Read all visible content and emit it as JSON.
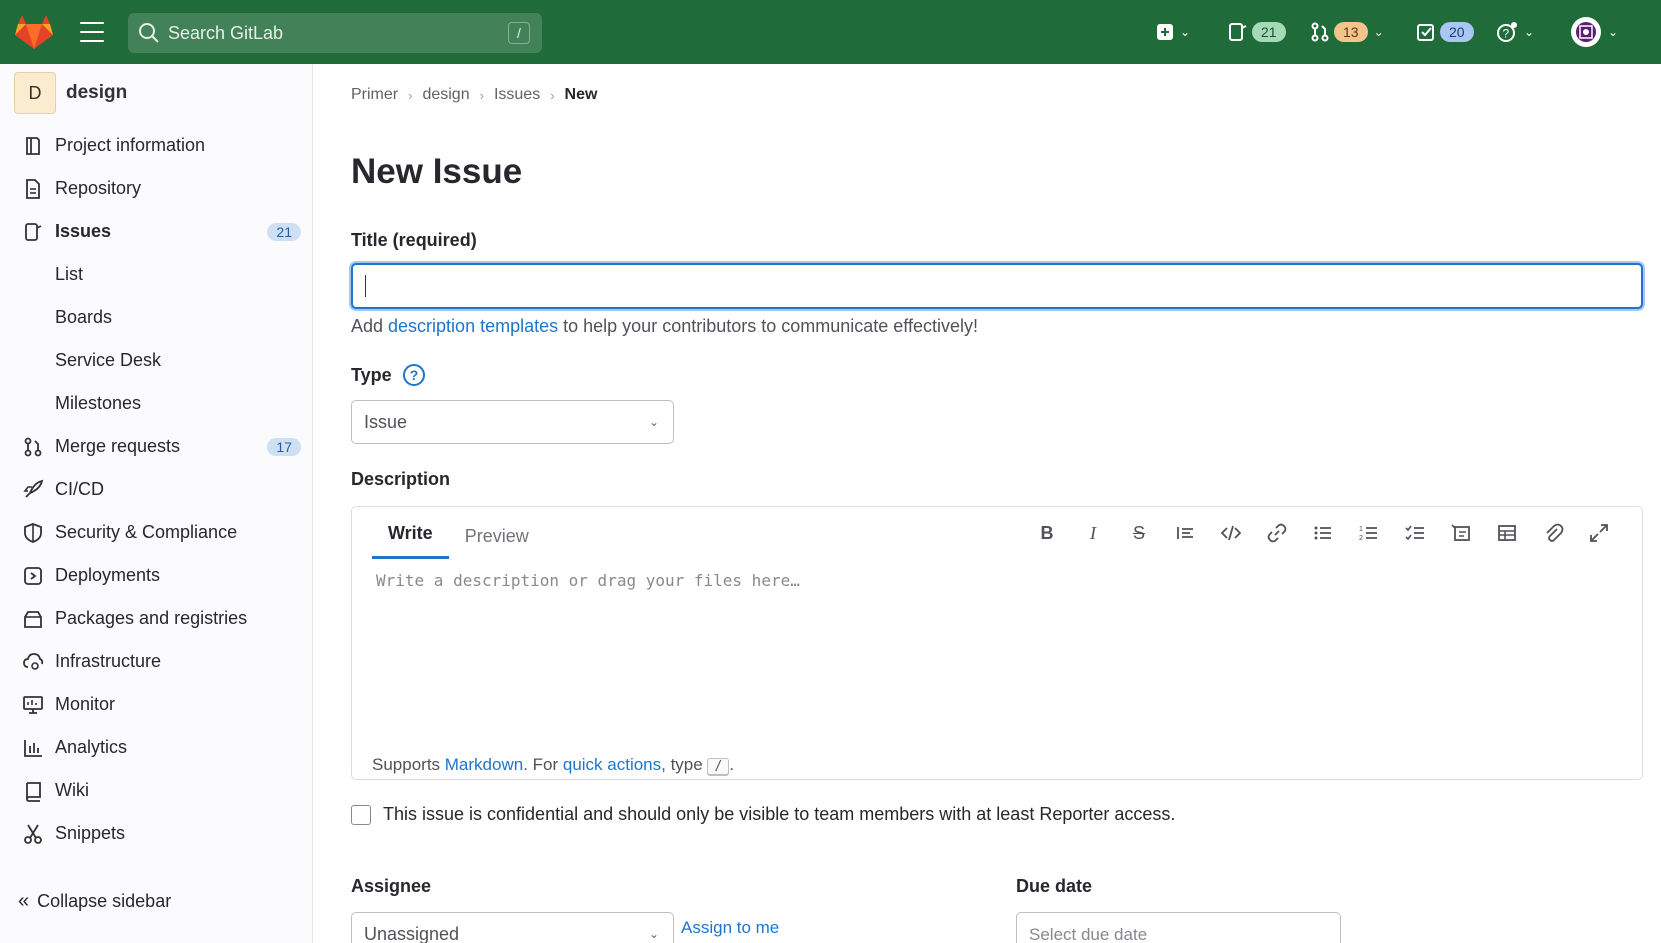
{
  "topbar": {
    "search_placeholder": "Search GitLab",
    "search_shortcut": "/",
    "issues_count": "21",
    "merge_requests_count": "13",
    "todos_count": "20"
  },
  "sidebar": {
    "project_initial": "D",
    "project_name": "design",
    "items": [
      {
        "label": "Project information",
        "icon": "project-info-icon"
      },
      {
        "label": "Repository",
        "icon": "repository-icon"
      },
      {
        "label": "Issues",
        "icon": "issues-icon",
        "count": "21"
      },
      {
        "label": "List"
      },
      {
        "label": "Boards"
      },
      {
        "label": "Service Desk"
      },
      {
        "label": "Milestones"
      },
      {
        "label": "Merge requests",
        "icon": "merge-request-icon",
        "count": "17"
      },
      {
        "label": "CI/CD",
        "icon": "rocket-icon"
      },
      {
        "label": "Security & Compliance",
        "icon": "shield-icon"
      },
      {
        "label": "Deployments",
        "icon": "deployments-icon"
      },
      {
        "label": "Packages and registries",
        "icon": "package-icon"
      },
      {
        "label": "Infrastructure",
        "icon": "cloud-gear-icon"
      },
      {
        "label": "Monitor",
        "icon": "monitor-icon"
      },
      {
        "label": "Analytics",
        "icon": "chart-icon"
      },
      {
        "label": "Wiki",
        "icon": "book-icon"
      },
      {
        "label": "Snippets",
        "icon": "scissors-icon"
      }
    ],
    "collapse_label": "Collapse sidebar"
  },
  "breadcrumb": [
    "Primer",
    "design",
    "Issues",
    "New"
  ],
  "page": {
    "title": "New Issue",
    "title_label": "Title (required)",
    "hint_prefix": "Add ",
    "hint_link": "description templates",
    "hint_suffix": " to help your contributors to communicate effectively!",
    "type_label": "Type",
    "type_value": "Issue",
    "description_label": "Description",
    "tab_write": "Write",
    "tab_preview": "Preview",
    "editor_placeholder": "Write a description or drag your files here…",
    "footer_prefix": "Supports ",
    "footer_markdown": "Markdown",
    "footer_mid": ". For ",
    "footer_quick": "quick actions",
    "footer_type": ", type ",
    "footer_kbd": "/",
    "footer_end": ".",
    "confidential_text": "This issue is confidential and should only be visible to team members with at least Reporter access.",
    "assignee_label": "Assignee",
    "assignee_value": "Unassigned",
    "assign_me": "Assign to me",
    "due_label": "Due date",
    "due_placeholder": "Select due date"
  },
  "colors": {
    "topbar": "#1f6b3a",
    "link": "#1f75cb",
    "focus": "#1f75cb"
  }
}
